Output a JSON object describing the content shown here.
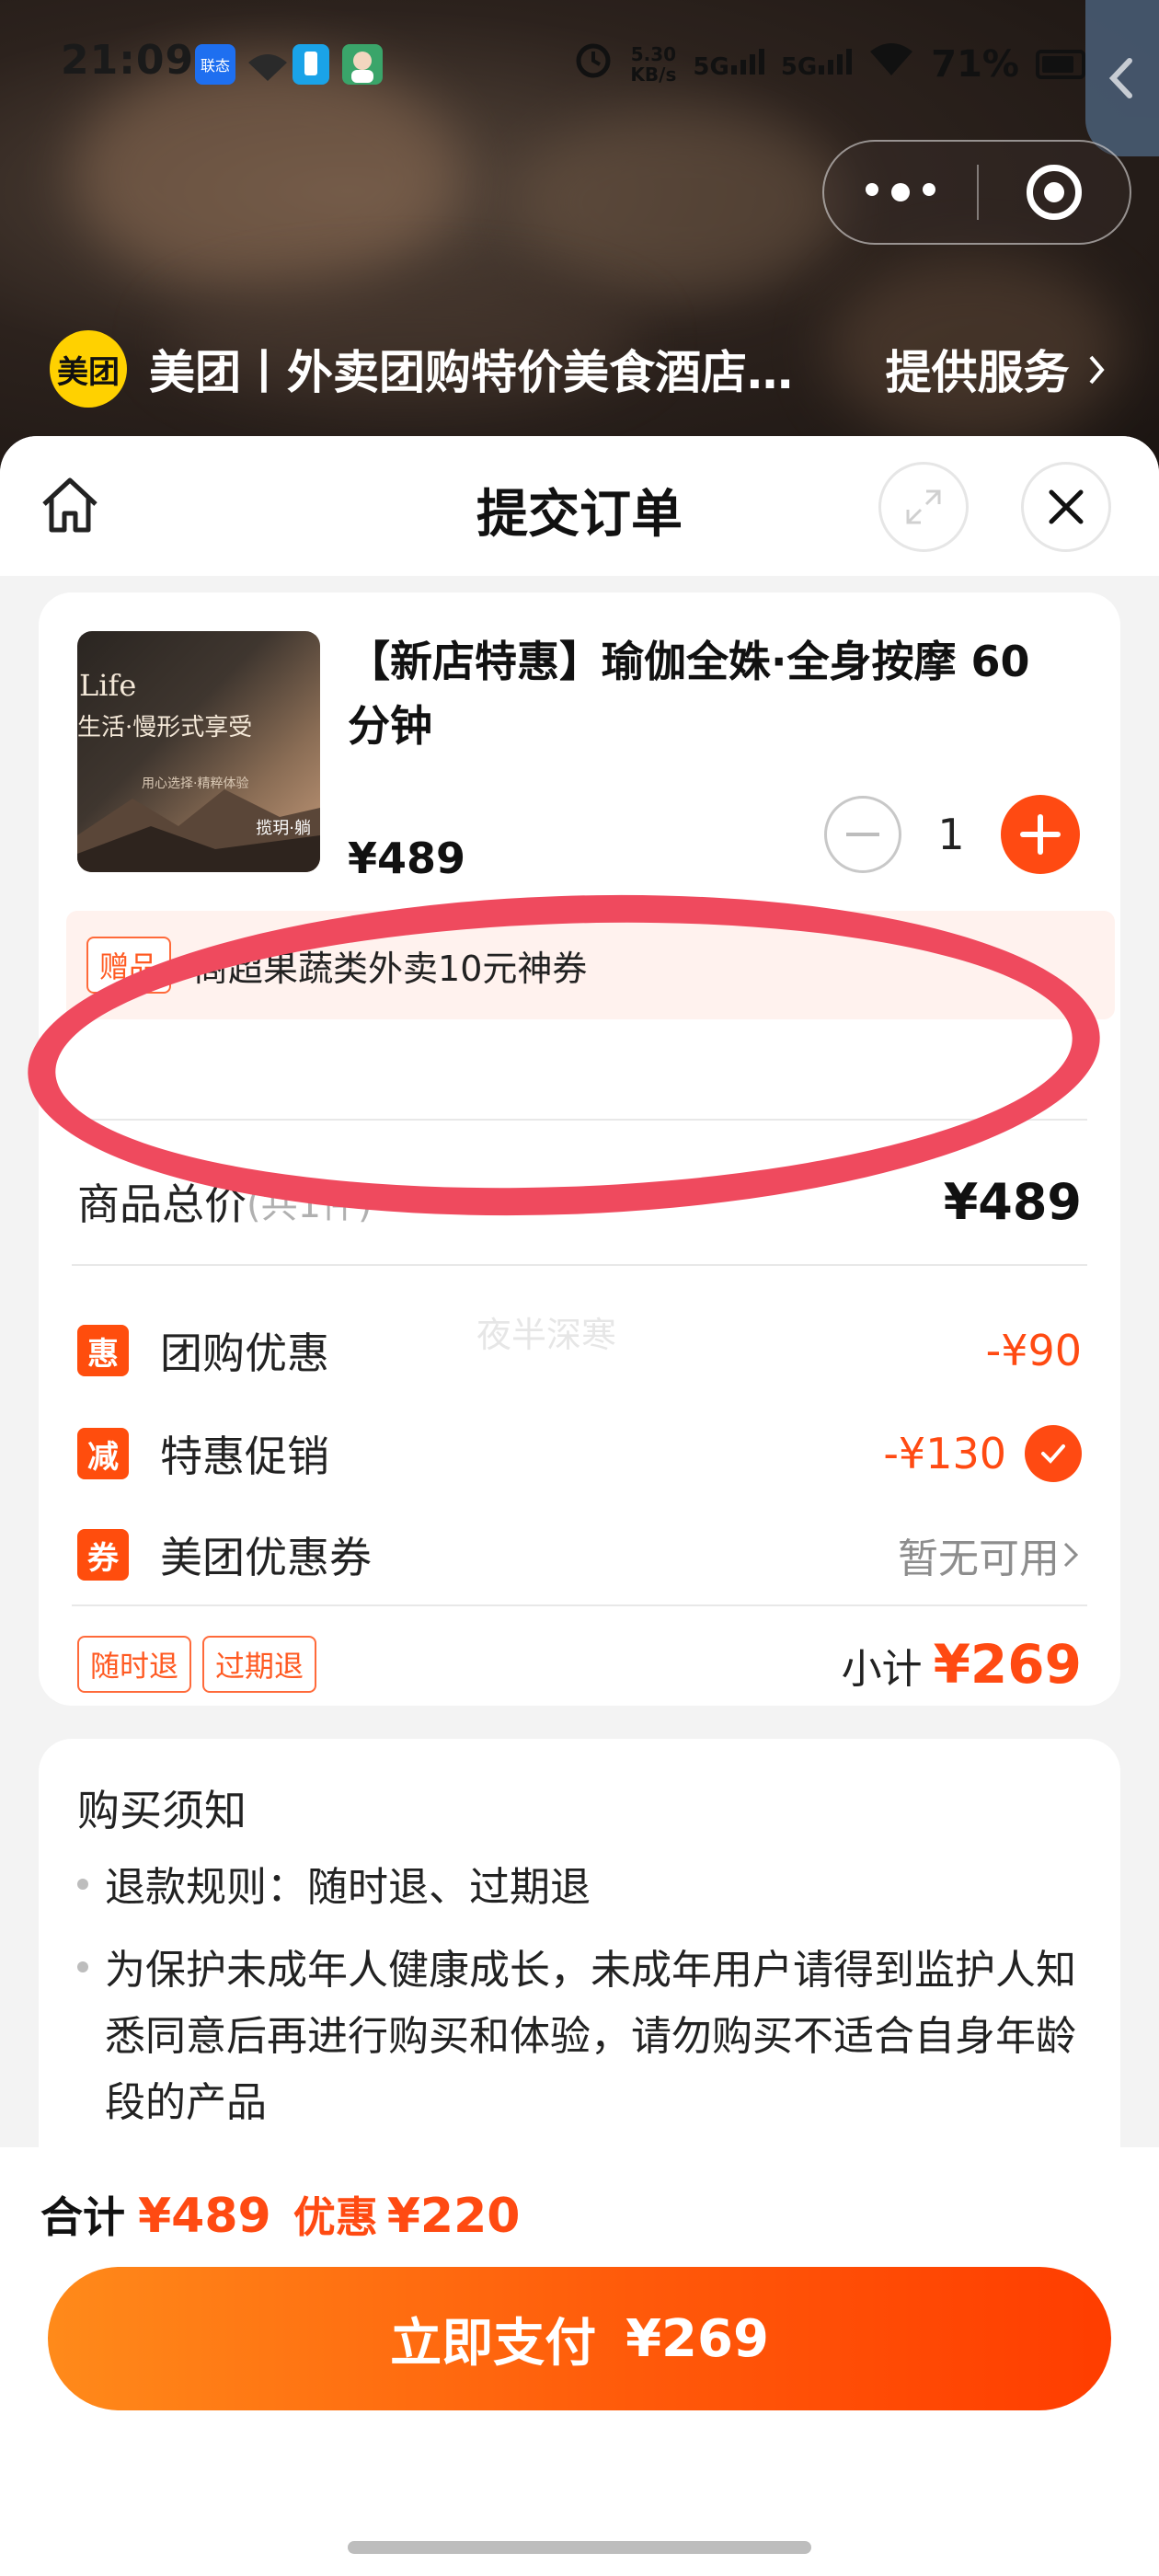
{
  "status_bar": {
    "time": "21:09",
    "net_speed": "5.30",
    "net_unit": "KB/s",
    "signal1": "5G",
    "signal2": "5G",
    "battery": "71%",
    "app_badge": "联态"
  },
  "provider": {
    "logo_text": "美团",
    "name": "美团丨外卖团购特价美食酒店…",
    "service_link": "提供服务"
  },
  "sheet": {
    "title": "提交订单"
  },
  "product": {
    "title": "【新店特惠】瑜伽全姝·全身按摩 60 分钟",
    "price_partial": "¥489",
    "quantity": "1",
    "thumbnail": {
      "line1": "Life",
      "line2": "生活·慢形式享受",
      "line3": "用心选择·精粹体验",
      "line4": "揽玥·躺"
    }
  },
  "gift": {
    "tag": "赠品",
    "text": "商超果蔬类外卖10元神券"
  },
  "summary": {
    "total_label": "商品总价",
    "total_sub": "(共1件)",
    "total_value": "¥489",
    "watermark": "夜半深寒",
    "discounts": [
      {
        "icon_text": "惠",
        "label": "团购优惠",
        "value": "-¥90"
      },
      {
        "icon_text": "减",
        "label": "特惠促销",
        "value": "-¥130"
      },
      {
        "icon_text": "券",
        "label": "美团优惠券",
        "value": "暂无可用"
      }
    ],
    "policy_tags": [
      "随时退",
      "过期退"
    ],
    "subtotal_label": "小计",
    "subtotal_value": "¥269"
  },
  "notice": {
    "title": "购买须知",
    "items": [
      "退款规则：随时退、过期退",
      "为保护未成年人健康成长，未成年用户请得到监护人知悉同意后再进行购买和体验，请勿购买不适合自身年龄段的产品"
    ]
  },
  "footer": {
    "total_label": "合计",
    "total_value": "¥489",
    "discount_label": "优惠",
    "discount_value": "¥220",
    "pay_label": "立即支付",
    "pay_amount": "¥269"
  },
  "colors": {
    "accent": "#ff4a12",
    "annotation_ring": "#ef4a5e",
    "provider_logo": "#ffd100"
  }
}
